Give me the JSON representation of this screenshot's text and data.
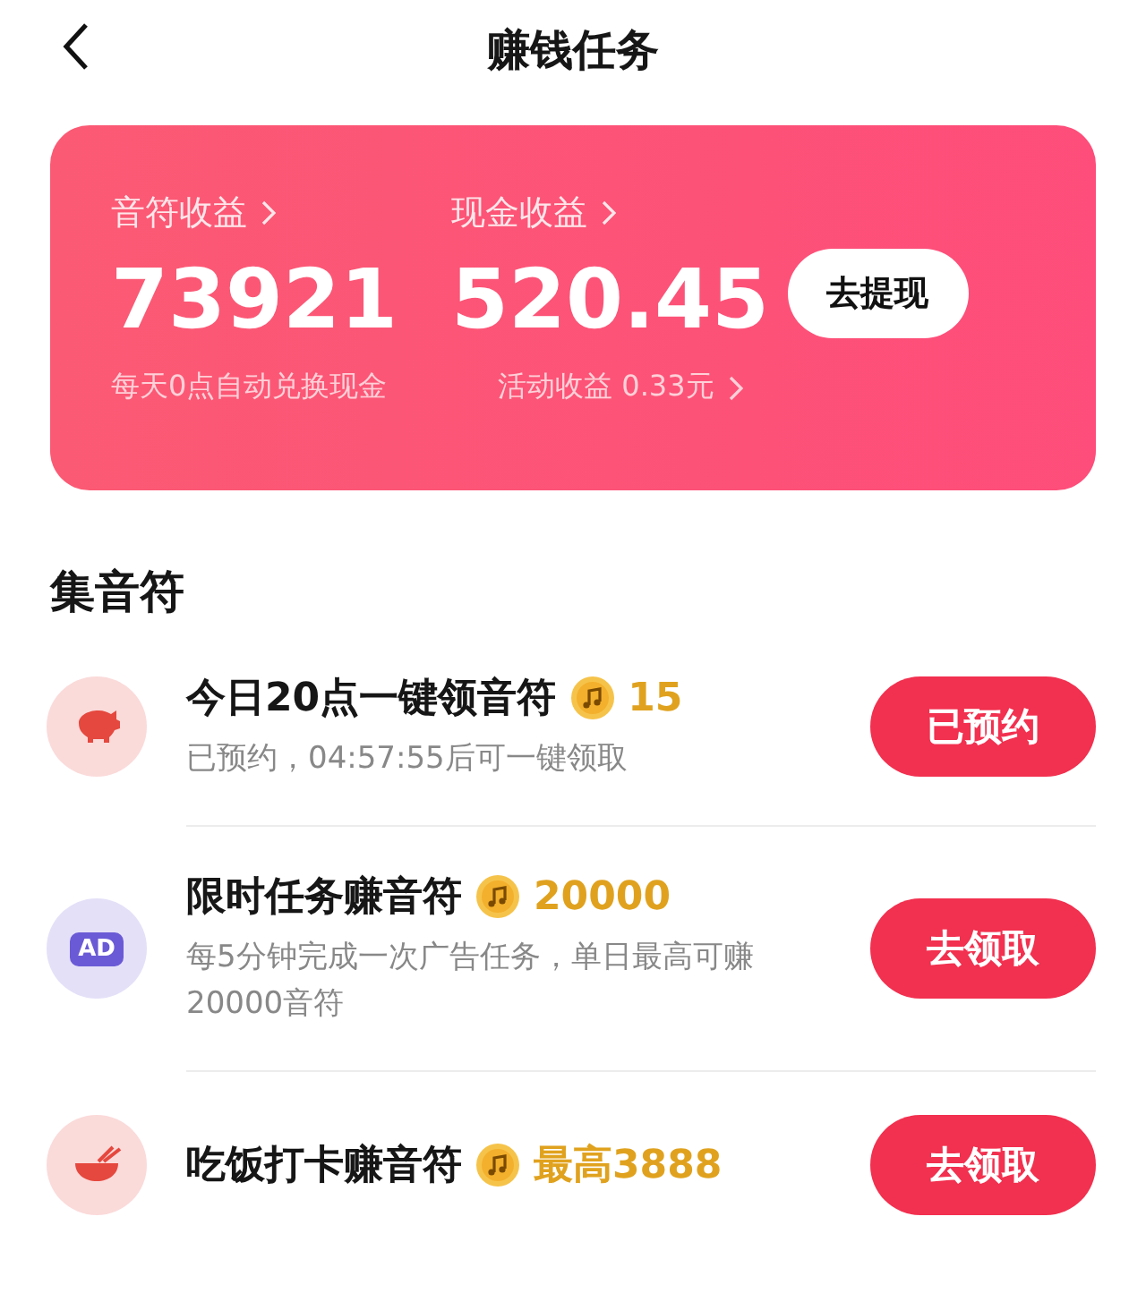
{
  "header": {
    "title": "赚钱任务"
  },
  "earnings": {
    "notes": {
      "label": "音符收益",
      "value": "73921",
      "caption": "每天0点自动兑换现金"
    },
    "cash": {
      "label": "现金收益",
      "value": "520.45",
      "caption": "活动收益 0.33元"
    },
    "withdraw_button": "去提现"
  },
  "section_title": "集音符",
  "tasks": [
    {
      "kind": "piggy",
      "title": "今日20点一键领音符",
      "reward": "15",
      "description": "已预约，04:57:55后可一键领取",
      "button": "已预约"
    },
    {
      "kind": "ad",
      "icon_text": "AD",
      "title": "限时任务赚音符",
      "reward": "20000",
      "description": "每5分钟完成一次广告任务，单日最高可赚20000音符",
      "button": "去领取"
    },
    {
      "kind": "bowl",
      "title": "吃饭打卡赚音符",
      "reward": "最高3888",
      "button": "去领取"
    }
  ]
}
